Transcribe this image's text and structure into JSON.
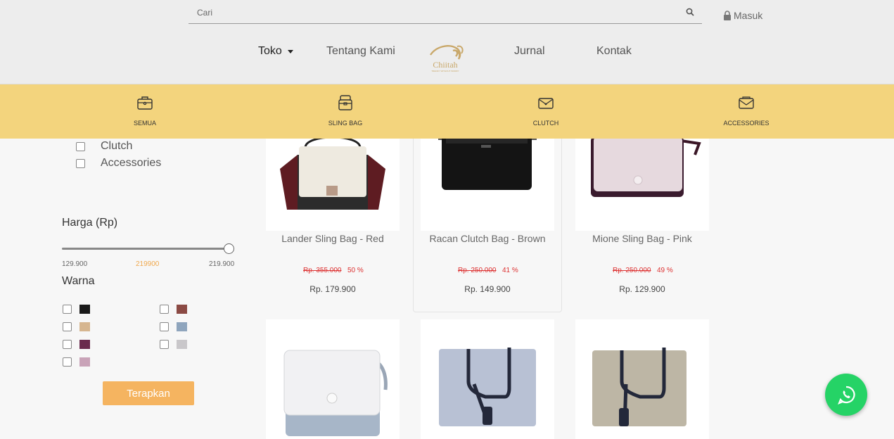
{
  "header": {
    "search_placeholder": "Cari",
    "login_label": "Masuk",
    "nav": {
      "toko": "Toko",
      "tentang": "Tentang Kami",
      "jurnal": "Jurnal",
      "kontak": "Kontak"
    },
    "logo_text": "Chiitah",
    "logo_tagline": "TRENDY WITHOUT WORRY"
  },
  "categories": [
    {
      "label": "SEMUA",
      "icon": "bag-icon"
    },
    {
      "label": "SLING BAG",
      "icon": "sling-bag-icon"
    },
    {
      "label": "CLUTCH",
      "icon": "clutch-icon"
    },
    {
      "label": "ACCESSORIES",
      "icon": "accessories-icon"
    }
  ],
  "sidebar": {
    "type_filters": [
      "Clutch",
      "Accessories"
    ],
    "price_title": "Harga (Rp)",
    "price_min": "129.900",
    "price_current": "219900",
    "price_max": "219.900",
    "slider_value_fraction": 1.0,
    "color_title": "Warna",
    "colors": [
      "#1a1a1a",
      "#8b4a44",
      "#d6b690",
      "#8fa5bd",
      "#6a2b4d",
      "#c9c7ca",
      "#c9a3b8"
    ],
    "apply_label": "Terapkan"
  },
  "products": [
    {
      "name": "Lander Sling Bag - Red",
      "old_price": "Rp. 355.000",
      "discount": "50 %",
      "price": "Rp. 179.900"
    },
    {
      "name": "Racan Clutch Bag - Brown",
      "old_price": "Rp. 250.000",
      "discount": "41 %",
      "price": "Rp. 149.900"
    },
    {
      "name": "Mione Sling Bag - Pink",
      "old_price": "Rp. 250.000",
      "discount": "49 %",
      "price": "Rp. 129.900"
    }
  ],
  "whatsapp_icon": "whatsapp-icon",
  "colors": {
    "accent_bar": "#f3d47d",
    "apply_button": "#f5b460",
    "discount_red": "#dd3333",
    "whatsapp": "#25d366"
  }
}
